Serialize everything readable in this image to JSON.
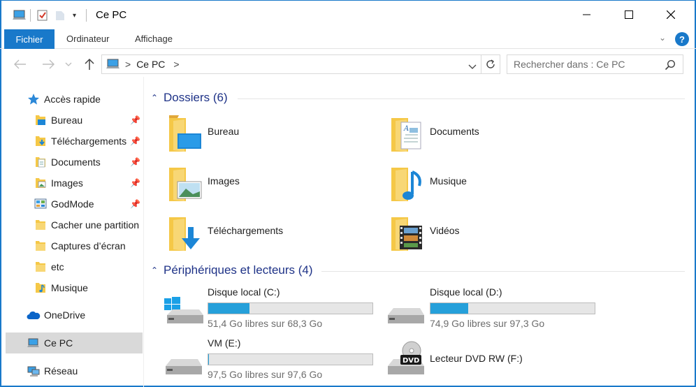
{
  "window": {
    "title": "Ce PC"
  },
  "ribbon": {
    "tabs": [
      "Fichier",
      "Ordinateur",
      "Affichage"
    ],
    "help": "?"
  },
  "address": {
    "path": "Ce PC",
    "separator": ">",
    "dropdown_icon": "chevron-down-icon"
  },
  "search": {
    "placeholder": "Rechercher dans : Ce PC"
  },
  "sidebar": {
    "items": [
      {
        "label": "Accès rapide",
        "icon": "star-icon"
      },
      {
        "label": "Bureau",
        "icon": "desktop-folder-icon",
        "pinned": true
      },
      {
        "label": "Téléchargements",
        "icon": "download-folder-icon",
        "pinned": true
      },
      {
        "label": "Documents",
        "icon": "documents-folder-icon",
        "pinned": true
      },
      {
        "label": "Images",
        "icon": "pictures-folder-icon",
        "pinned": true
      },
      {
        "label": "GodMode",
        "icon": "control-panel-icon",
        "pinned": true
      },
      {
        "label": "Cacher une partition",
        "icon": "folder-icon"
      },
      {
        "label": "Captures d’écran",
        "icon": "folder-icon"
      },
      {
        "label": "etc",
        "icon": "folder-icon"
      },
      {
        "label": "Musique",
        "icon": "music-folder-icon"
      },
      {
        "label": "OneDrive",
        "icon": "cloud-icon"
      },
      {
        "label": "Ce PC",
        "icon": "computer-icon",
        "selected": true
      },
      {
        "label": "Réseau",
        "icon": "network-icon"
      }
    ]
  },
  "main": {
    "folders_section": {
      "title": "Dossiers (6)"
    },
    "folders": [
      {
        "name": "Bureau",
        "icon": "desktop-folder-icon"
      },
      {
        "name": "Documents",
        "icon": "documents-folder-icon"
      },
      {
        "name": "Images",
        "icon": "pictures-folder-icon"
      },
      {
        "name": "Musique",
        "icon": "music-folder-icon"
      },
      {
        "name": "Téléchargements",
        "icon": "download-folder-icon"
      },
      {
        "name": "Vidéos",
        "icon": "videos-folder-icon"
      }
    ],
    "drives_section": {
      "title": "Périphériques et lecteurs (4)"
    },
    "drives": [
      {
        "name": "Disque local (C:)",
        "free": "51,4 Go libres sur 68,3 Go",
        "used_fraction": 0.25,
        "icon": "windows-drive-icon"
      },
      {
        "name": "Disque local (D:)",
        "free": "74,9 Go libres sur 97,3 Go",
        "used_fraction": 0.23,
        "icon": "hard-drive-icon"
      },
      {
        "name": "VM (E:)",
        "free": "97,5 Go libres sur 97,6 Go",
        "used_fraction": 0.001,
        "icon": "hard-drive-icon"
      },
      {
        "name": "Lecteur DVD RW (F:)",
        "icon": "dvd-drive-icon"
      }
    ]
  },
  "colors": {
    "accent": "#1979ca",
    "section_title": "#1e3287",
    "bar_fill": "#26a0da",
    "selected_bg": "#d9d9d9"
  }
}
